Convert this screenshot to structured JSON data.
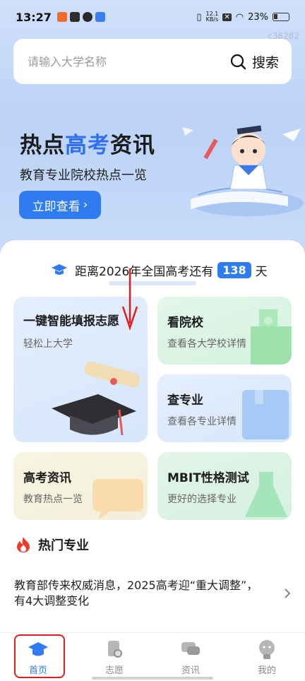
{
  "status_bar": {
    "time": "13:27",
    "net_speed_top": "12.1",
    "net_speed_unit": "KB/s",
    "battery": "23%",
    "corner_id": "c38282"
  },
  "search": {
    "placeholder": "请输入大学名称",
    "button_label": "搜索"
  },
  "banner": {
    "title_part1": "热点",
    "title_accent": "高考",
    "title_part2": "资讯",
    "subtitle": "教育专业院校热点一览",
    "button_label": "立即查看",
    "button_arrow": "›"
  },
  "countdown": {
    "prefix": "距离2026年全国高考还有",
    "days": "138",
    "suffix": "天"
  },
  "tiles": [
    {
      "title": "一键智能填报志愿",
      "subtitle": "轻松上大学"
    },
    {
      "title": "看院校",
      "subtitle": "查看各大学校详情"
    },
    {
      "title": "查专业",
      "subtitle": "查看各专业详情"
    },
    {
      "title": "高考资讯",
      "subtitle": "教育热点一览"
    },
    {
      "title": "MBIT性格测试",
      "subtitle": "更好的选择专业"
    }
  ],
  "section": {
    "title": "热门专业"
  },
  "news": [
    {
      "text": "教育部传来权威消息，2025高考迎“重大调整”，有4大调整变化"
    }
  ],
  "tabbar": {
    "items": [
      {
        "label": "首页",
        "active": true
      },
      {
        "label": "志愿",
        "active": false
      },
      {
        "label": "资讯",
        "active": false
      },
      {
        "label": "我的",
        "active": false
      }
    ]
  },
  "colors": {
    "accent": "#2f7bf2",
    "annotation": "#e01e1e"
  }
}
